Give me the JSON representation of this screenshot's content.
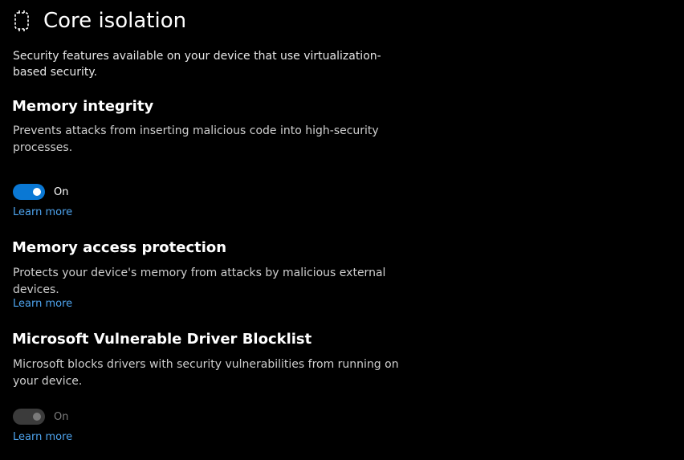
{
  "page": {
    "title": "Core isolation",
    "icon": "core-isolation-chip-icon",
    "description": "Security features available on your device that use virtualization-based security."
  },
  "colors": {
    "background": "#000000",
    "accent": "#0a78d4",
    "link": "#4ea4ee",
    "disabled": "#3b3b3b"
  },
  "sections": [
    {
      "title": "Memory integrity",
      "description": "Prevents attacks from inserting malicious code into high-security processes.",
      "toggle": {
        "state_label": "On",
        "checked": true,
        "enabled": true
      },
      "learn_more": "Learn more"
    },
    {
      "title": "Memory access protection",
      "description": "Protects your device's memory from attacks by malicious external devices.",
      "learn_more": "Learn more"
    },
    {
      "title": "Microsoft Vulnerable Driver Blocklist",
      "description": "Microsoft blocks drivers with security vulnerabilities from running on your device.",
      "toggle": {
        "state_label": "On",
        "checked": true,
        "enabled": false
      },
      "learn_more": "Learn more"
    }
  ]
}
